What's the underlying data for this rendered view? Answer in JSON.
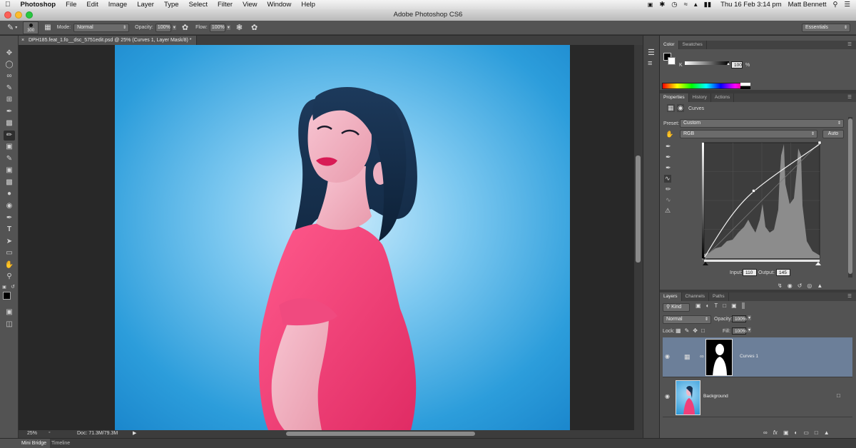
{
  "menubar": {
    "apple_icon": "apple-icon",
    "app_name": "Photoshop",
    "items": [
      "File",
      "Edit",
      "Image",
      "Layer",
      "Type",
      "Select",
      "Filter",
      "View",
      "Window",
      "Help"
    ],
    "clock": "Thu 16 Feb  3:14 pm",
    "user": "Matt Bennett"
  },
  "window": {
    "title": "Adobe Photoshop CS6"
  },
  "options": {
    "brush_size": "300",
    "mode_label": "Mode:",
    "mode_value": "Normal",
    "opacity_label": "Opacity:",
    "opacity_value": "100%",
    "flow_label": "Flow:",
    "flow_value": "100%",
    "workspace": "Essentials"
  },
  "document": {
    "tab_label": "DPH185.feat_1.fo__dsc_5751edit.psd @ 25% (Curves 1, Layer Mask/8) *",
    "zoom": "25%",
    "doc_info": "Doc: 71.3M/79.3M"
  },
  "bottom_tabs": [
    "Mini Bridge",
    "Timeline"
  ],
  "color_panel": {
    "tabs": [
      "Color",
      "Swatches"
    ],
    "channel_label": "K",
    "value": "100",
    "unit": "%"
  },
  "properties_panel": {
    "tabs": [
      "Properties",
      "History",
      "Actions"
    ],
    "adjustment_name": "Curves",
    "preset_label": "Preset:",
    "preset_value": "Custom",
    "channel_value": "RGB",
    "auto_label": "Auto",
    "input_label": "Input:",
    "input_value": "110",
    "output_label": "Output:",
    "output_value": "145"
  },
  "layers_panel": {
    "tabs": [
      "Layers",
      "Channels",
      "Paths"
    ],
    "filter_label": "Kind",
    "blend_mode": "Normal",
    "opacity_label": "Opacity:",
    "opacity_value": "100%",
    "lock_label": "Lock:",
    "fill_label": "Fill:",
    "fill_value": "100%",
    "layers": [
      {
        "name": "Curves 1",
        "selected": true
      },
      {
        "name": "Background",
        "selected": false
      }
    ]
  },
  "colors": {
    "ui_dark": "#535353",
    "backdrop_blue": "#2f9fdc",
    "shirt_pink": "#f0407a",
    "selection": "#6c7f99"
  }
}
